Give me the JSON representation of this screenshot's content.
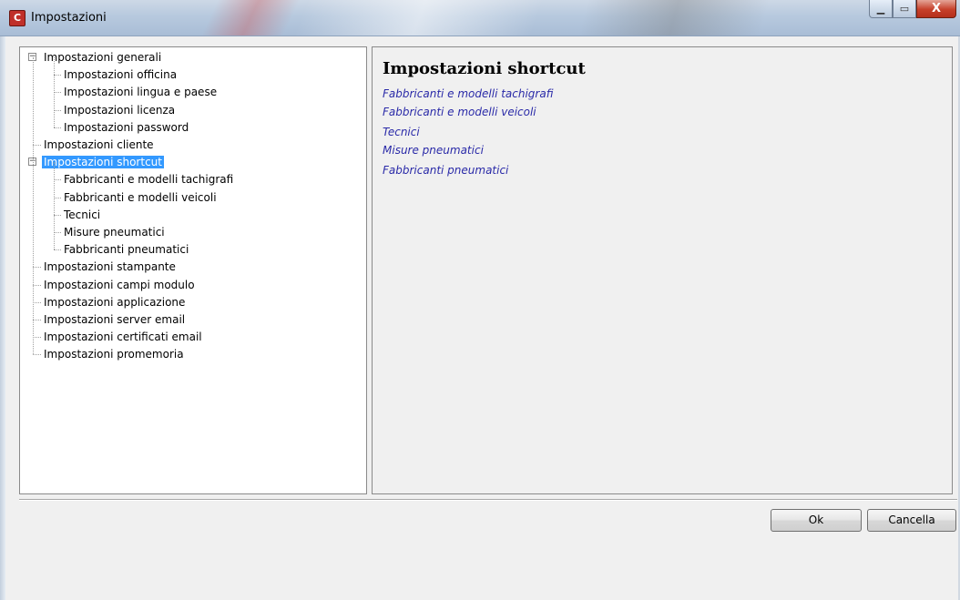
{
  "window": {
    "title": "Impostazioni",
    "app_icon_text": "C",
    "minimize_glyph": "▁",
    "maximize_glyph": "▭",
    "close_glyph": "X"
  },
  "tree": {
    "items": [
      {
        "label": "Impostazioni generali",
        "level": 0,
        "expander": "−"
      },
      {
        "label": "Impostazioni officina",
        "level": 1
      },
      {
        "label": "Impostazioni lingua e paese",
        "level": 1
      },
      {
        "label": "Impostazioni licenza",
        "level": 1
      },
      {
        "label": "Impostazioni password",
        "level": 1
      },
      {
        "label": "Impostazioni cliente",
        "level": 0
      },
      {
        "label": "Impostazioni shortcut",
        "level": 0,
        "expander": "−",
        "selected": true
      },
      {
        "label": "Fabbricanti e modelli tachigrafi",
        "level": 1
      },
      {
        "label": "Fabbricanti e modelli veicoli",
        "level": 1
      },
      {
        "label": "Tecnici",
        "level": 1
      },
      {
        "label": "Misure pneumatici",
        "level": 1
      },
      {
        "label": "Fabbricanti pneumatici",
        "level": 1
      },
      {
        "label": "Impostazioni stampante",
        "level": 0
      },
      {
        "label": "Impostazioni campi modulo",
        "level": 0
      },
      {
        "label": "Impostazioni applicazione",
        "level": 0
      },
      {
        "label": "Impostazioni server email",
        "level": 0
      },
      {
        "label": "Impostazioni certificati email",
        "level": 0
      },
      {
        "label": "Impostazioni promemoria",
        "level": 0
      }
    ]
  },
  "content": {
    "title": "Impostazioni shortcut",
    "links": [
      "Fabbricanti e modelli tachigrafi",
      "Fabbricanti e modelli veicoli",
      "Tecnici",
      "Misure pneumatici",
      "Fabbricanti pneumatici"
    ]
  },
  "buttons": {
    "ok": "Ok",
    "cancel": "Cancella"
  }
}
